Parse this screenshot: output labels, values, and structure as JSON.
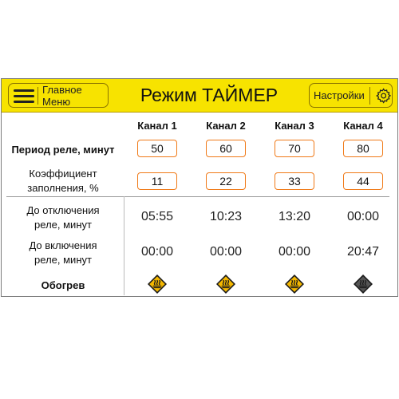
{
  "header": {
    "menu_label": "Главное Меню",
    "title": "Режим ТАЙМЕР",
    "settings_label": "Настройки"
  },
  "rows": {
    "period": "Период реле, минут",
    "duty_line1": "Коэффициент",
    "duty_line2": "заполнения, %",
    "off_line1": "До отключения",
    "off_line2": "реле, минут",
    "on_line1": "До включения",
    "on_line2": "реле, минут",
    "heating": "Обогрев"
  },
  "channels": [
    {
      "name": "Канал 1",
      "period": "50",
      "duty": "11",
      "until_off": "05:55",
      "until_on": "00:00",
      "heating_active": true
    },
    {
      "name": "Канал 2",
      "period": "60",
      "duty": "22",
      "until_off": "10:23",
      "until_on": "00:00",
      "heating_active": true
    },
    {
      "name": "Канал 3",
      "period": "70",
      "duty": "33",
      "until_off": "13:20",
      "until_on": "00:00",
      "heating_active": true
    },
    {
      "name": "Канал 4",
      "period": "80",
      "duty": "44",
      "until_off": "00:00",
      "until_on": "20:47",
      "heating_active": false
    }
  ],
  "icons": {
    "menu": "hamburger-icon",
    "settings": "gear-icon",
    "heating": "heater-icon"
  },
  "colors": {
    "header_bg": "#f7e300",
    "field_border": "#f07a18",
    "heat_active": "#f5b800",
    "heat_inactive": "#555555"
  }
}
